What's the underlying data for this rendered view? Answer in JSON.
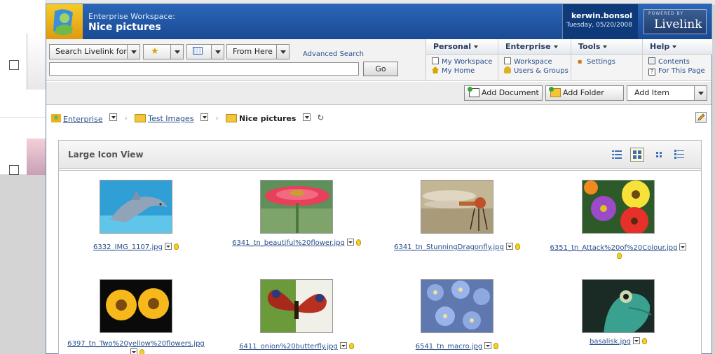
{
  "window": {
    "subtitle": "Enterprise Workspace:",
    "title": "Nice pictures",
    "user": "kerwin.bonsol",
    "date": "Tuesday, 05/20/2008",
    "brand_powered": "POWERED BY",
    "brand_name": "Livelink"
  },
  "search": {
    "scope_label": "Search Livelink for",
    "location_label": "From Here",
    "advanced_label": "Advanced Search",
    "query_value": "",
    "go_label": "Go"
  },
  "menus": [
    {
      "label": "Personal",
      "items": [
        "My Workspace",
        "My Home"
      ]
    },
    {
      "label": "Enterprise",
      "items": [
        "Workspace",
        "Users & Groups"
      ]
    },
    {
      "label": "Tools",
      "items": [
        "Settings"
      ]
    },
    {
      "label": "Help",
      "items": [
        "Contents",
        "For This Page"
      ]
    }
  ],
  "toolbar": {
    "add_document": "Add Document",
    "add_folder": "Add Folder",
    "add_item": "Add Item"
  },
  "breadcrumb": {
    "root": "Enterprise",
    "parent": "Test Images",
    "current": "Nice pictures"
  },
  "view": {
    "title": "Large Icon View",
    "modes": [
      "detail-list",
      "large-icons",
      "small-icons",
      "list"
    ]
  },
  "items": [
    {
      "name": "6332_IMG_1107.jpg",
      "image": "dolphin"
    },
    {
      "name": "6341_tn_beautiful%20flower.jpg",
      "image": "pink-flower"
    },
    {
      "name": "6341_tn_StunningDragonfly.jpg",
      "image": "dragonfly"
    },
    {
      "name": "6351_tn_Attack%20of%20Colour.jpg",
      "image": "colorful-flowers"
    },
    {
      "name": "6397_tn_Two%20yellow%20flowers.jpg",
      "image": "yellow-flowers"
    },
    {
      "name": "6411_onion%20butterfly.jpg",
      "image": "butterfly"
    },
    {
      "name": "6541_tn_macro.jpg",
      "image": "blue-flowers"
    },
    {
      "name": "basalisk.jpg",
      "image": "lizard"
    }
  ]
}
